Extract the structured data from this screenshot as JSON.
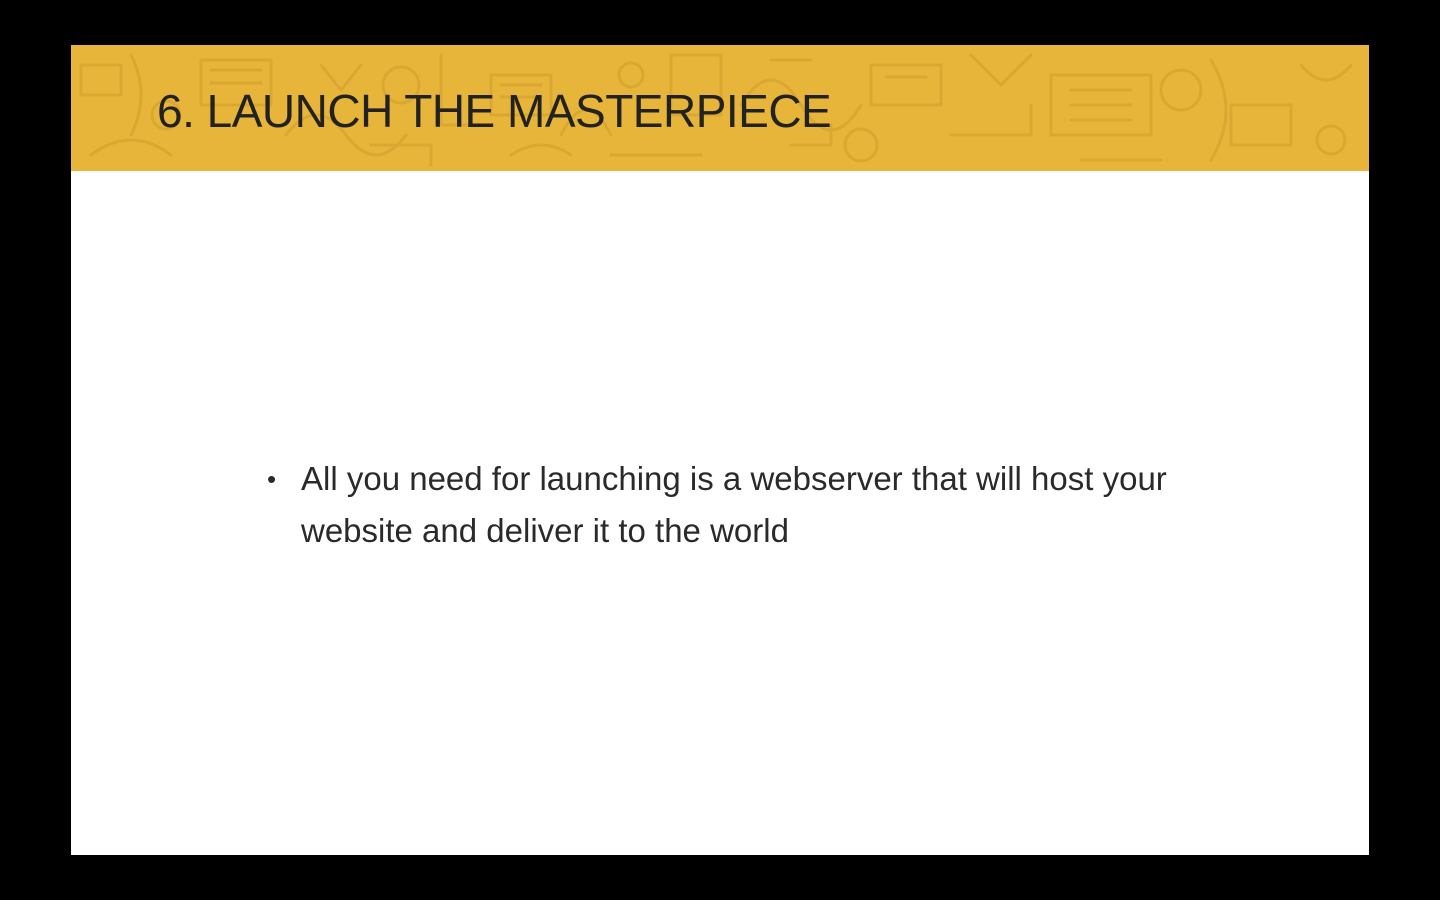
{
  "slide": {
    "title": "6. LAUNCH THE MASTERPIECE",
    "bullets": [
      {
        "marker": "•",
        "text": "All you need for launching is a webserver that will host your website and deliver it to the world"
      }
    ]
  },
  "colors": {
    "background": "#000000",
    "slide_background": "#ffffff",
    "header_band": "#e8b53b",
    "header_pattern": "#d9a630",
    "title_text": "#222222",
    "body_text": "#2a2a2a"
  },
  "icons": {
    "header_pattern": "doodle-pattern-icon"
  }
}
